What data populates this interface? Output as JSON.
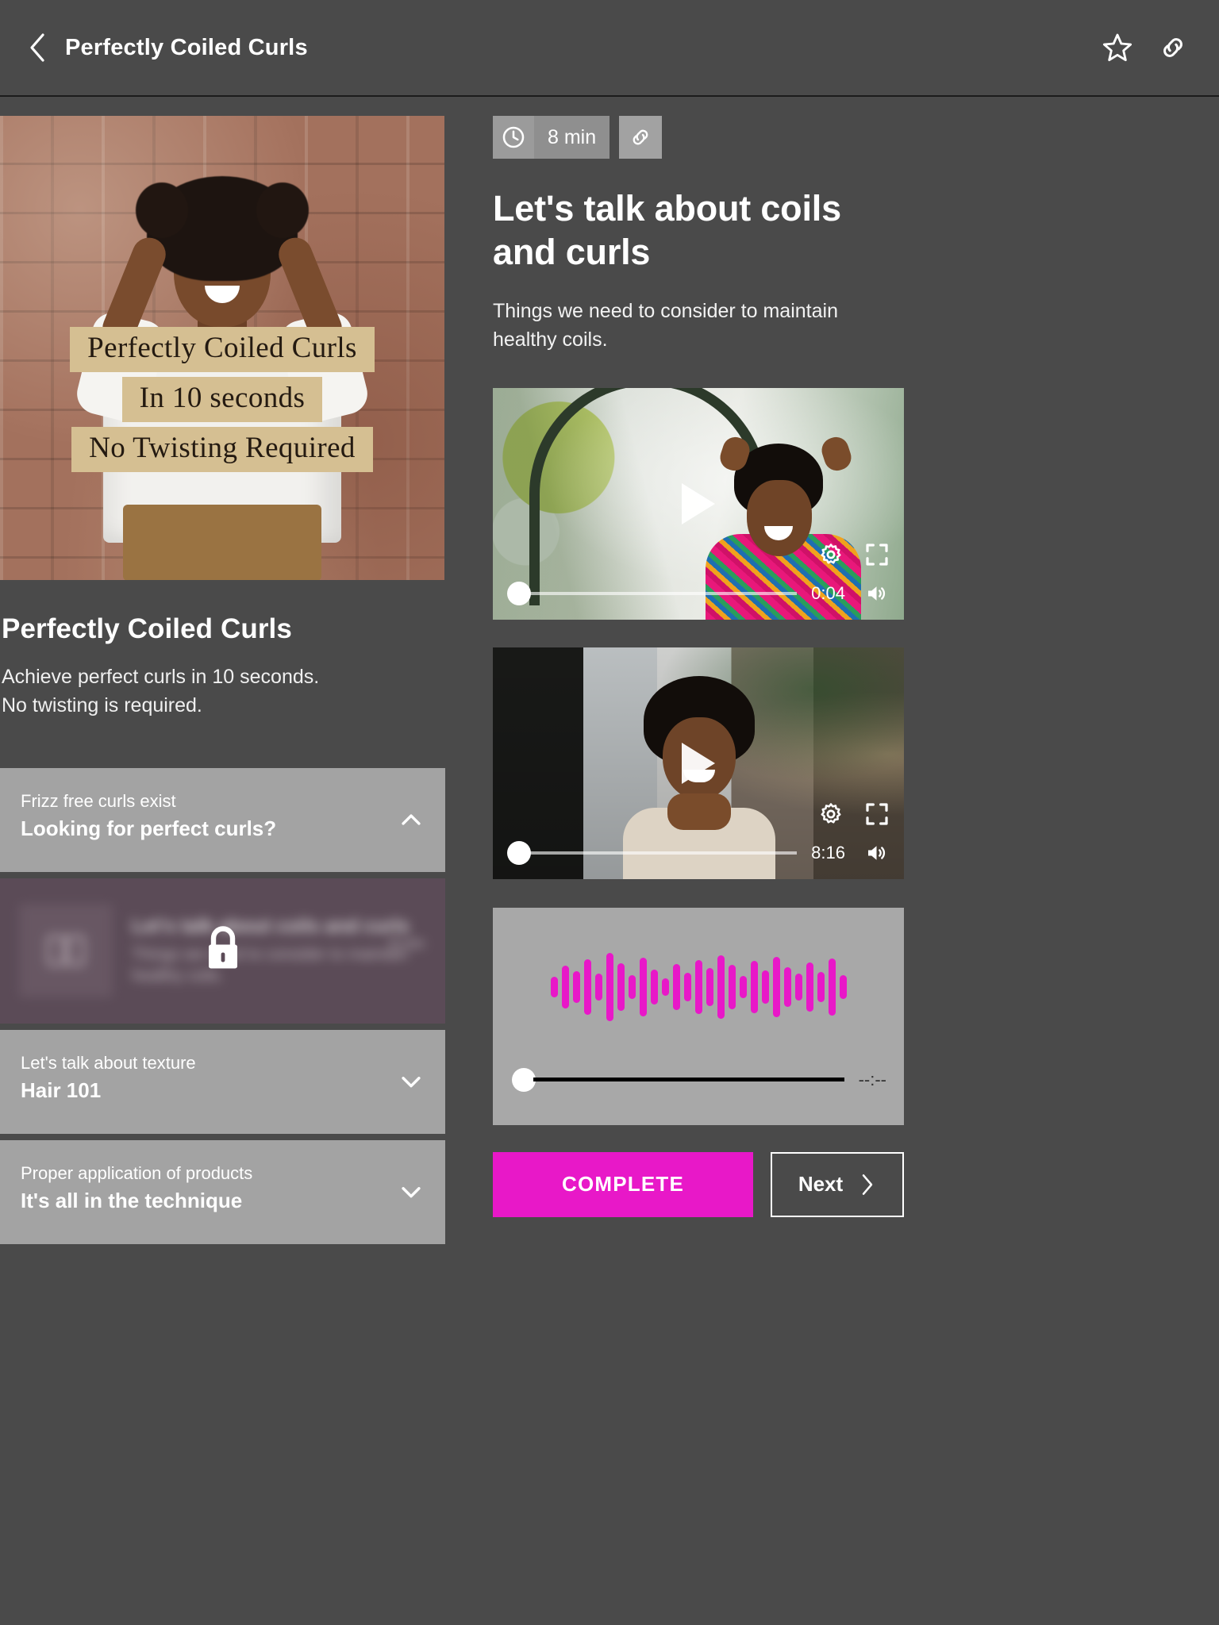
{
  "header": {
    "title": "Perfectly Coiled Curls",
    "back_icon": "chevron-left-icon",
    "favorite_icon": "star-icon",
    "share_icon": "link-icon"
  },
  "left": {
    "hero_lines": [
      "Perfectly Coiled Curls",
      "In 10 seconds",
      "No Twisting Required"
    ],
    "course_title": "Perfectly Coiled Curls",
    "course_desc_line1": "Achieve perfect curls in 10 seconds.",
    "course_desc_line2": "No twisting is required.",
    "sections": [
      {
        "subtitle": "Frizz free curls exist",
        "title": "Looking for perfect curls?",
        "chevron": "chevron-up-icon",
        "expanded": true
      },
      {
        "subtitle": "Let's talk about texture",
        "title": "Hair 101",
        "chevron": "chevron-down-icon",
        "expanded": false
      },
      {
        "subtitle": "Proper application of products",
        "title": "It's all in the technique",
        "chevron": "chevron-down-icon",
        "expanded": false
      }
    ],
    "locked_lesson": {
      "title": "Let's talk about coils and curls",
      "desc": "Things we need to consider to maintain healthy coils.",
      "duration": "8 min",
      "thumb_icon": "book-icon",
      "lock_icon": "lock-icon"
    }
  },
  "right": {
    "duration_badge": "8 min",
    "clock_icon": "clock-icon",
    "link_icon": "link-icon",
    "lesson_title": "Let's talk about coils and curls",
    "lesson_desc": "Things we need to consider to maintain healthy coils.",
    "videos": [
      {
        "time": "0:04",
        "play_icon": "play-icon",
        "settings_icon": "gear-icon",
        "fullscreen_icon": "fullscreen-icon",
        "volume_icon": "volume-icon",
        "progress_percent": 2
      },
      {
        "time": "8:16",
        "play_icon": "play-icon",
        "settings_icon": "gear-icon",
        "fullscreen_icon": "fullscreen-icon",
        "volume_icon": "volume-icon",
        "progress_percent": 0
      }
    ],
    "audio": {
      "time": "--:--",
      "waveform_color": "#e818c8",
      "bars": [
        26,
        54,
        40,
        70,
        34,
        86,
        60,
        30,
        74,
        44,
        22,
        58,
        36,
        68,
        48,
        80,
        56,
        28,
        66,
        42,
        76,
        50,
        34,
        62,
        38,
        72,
        30
      ]
    },
    "complete_button": "COMPLETE",
    "next_button": "Next",
    "next_icon": "chevron-right-icon"
  },
  "colors": {
    "background": "#4a4a4a",
    "accordion": "#a3a3a3",
    "accent": "#e818c8",
    "locked": "#5b4b57"
  }
}
